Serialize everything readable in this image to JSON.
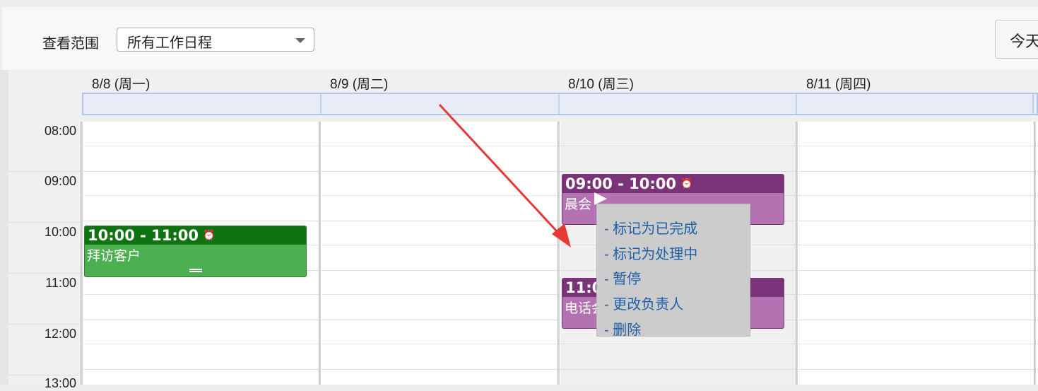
{
  "toolbar": {
    "scope_label": "查看范围",
    "scope_value": "所有工作日程",
    "today_label": "今天"
  },
  "calendar": {
    "days": [
      {
        "label": "8/8 (周一)"
      },
      {
        "label": "8/9 (周二)"
      },
      {
        "label": "8/10 (周三)"
      },
      {
        "label": "8/11 (周四)"
      }
    ],
    "hours": [
      "08:00",
      "09:00",
      "10:00",
      "11:00",
      "12:00",
      "13:00"
    ]
  },
  "events": [
    {
      "time": "10:00 - 11:00",
      "title": "拜访客户",
      "color": "#4caf50"
    },
    {
      "time": "09:00 - 10:00",
      "title": "晨会",
      "color": "#b572b3"
    },
    {
      "time": "11:00",
      "title": "电话会",
      "color": "#b572b3"
    }
  ],
  "context_menu": {
    "items": [
      {
        "label": "- 标记为已完成"
      },
      {
        "label": "- 标记为处理中"
      },
      {
        "label": "- 暂停"
      },
      {
        "label": "- 更改负责人"
      },
      {
        "label": "- 删除"
      }
    ]
  },
  "colors": {
    "annotation_arrow": "#e53935",
    "menu_link": "#1e5fa8"
  }
}
